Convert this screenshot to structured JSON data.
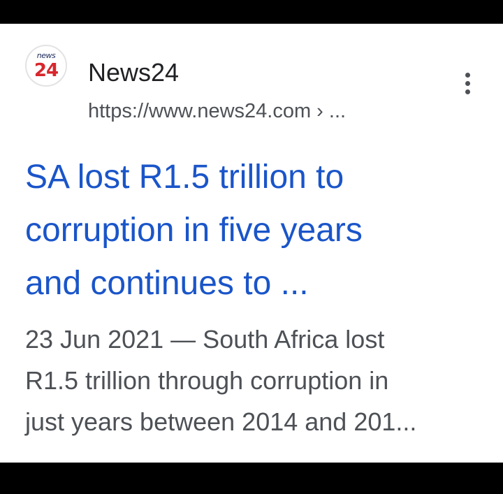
{
  "result": {
    "logo": {
      "top_text": "news",
      "number": "24"
    },
    "site_name": "News24",
    "url": "https://www.news24.com › ...",
    "menu_icon": "more-vert-icon",
    "title_lines": [
      "SA lost R1.5 trillion to",
      "corruption in five years",
      "and continues to ..."
    ],
    "snippet_lines": [
      "23 Jun 2021 — South Africa lost",
      "R1.5 trillion through corruption in",
      "just years between 2014 and 201..."
    ]
  },
  "colors": {
    "title_link": "#1a55c9",
    "snippet_text": "#4d5156",
    "site_name": "#202124",
    "logo_red": "#d7262c",
    "background": "#ffffff",
    "frame": "#000000"
  }
}
